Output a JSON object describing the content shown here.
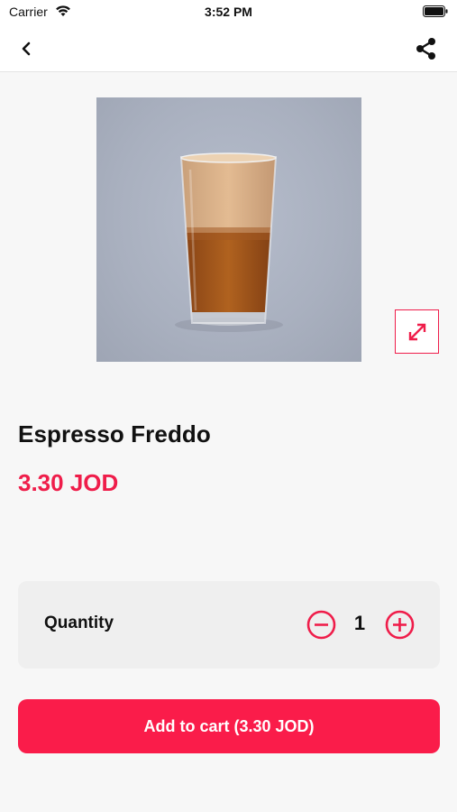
{
  "status_bar": {
    "carrier": "Carrier",
    "time": "3:52 PM"
  },
  "nav": {
    "back_icon": "chevron-left-icon",
    "share_icon": "share-icon"
  },
  "product": {
    "image_alt": "Espresso Freddo drink in a tall glass",
    "expand_icon": "expand-arrows-icon",
    "title": "Espresso Freddo",
    "price": "3.30 JOD"
  },
  "quantity": {
    "label": "Quantity",
    "value": "1",
    "minus_icon": "minus-circle-icon",
    "plus_icon": "plus-circle-icon"
  },
  "cart": {
    "button_label": "Add to cart (3.30 JOD)"
  },
  "colors": {
    "accent": "#ef1d4a",
    "background": "#f7f7f7",
    "card": "#efefef"
  }
}
